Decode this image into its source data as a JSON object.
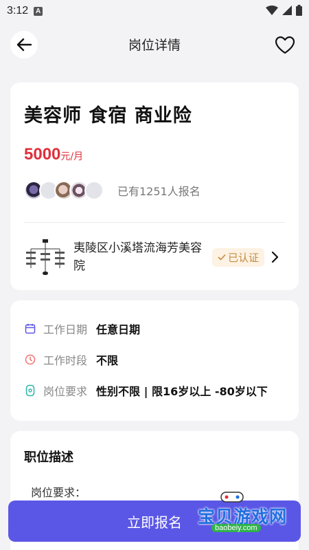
{
  "status_bar": {
    "time": "3:12",
    "badge": "A"
  },
  "header": {
    "title": "岗位详情"
  },
  "job": {
    "title": "美容师 食宿 商业险",
    "salary_amount": "5000",
    "salary_unit": "元/月",
    "applicants": "已有1251人报名"
  },
  "company": {
    "name": "夷陵区小溪塔流海芳美容院",
    "verified_label": "已认证"
  },
  "info": [
    {
      "icon": "calendar-icon",
      "label": "工作日期",
      "value": "任意日期"
    },
    {
      "icon": "clock-icon",
      "label": "工作时段",
      "value": "不限"
    },
    {
      "icon": "requirement-icon",
      "label": "岗位要求",
      "value": "性别不限 | 限16岁以上 -80岁以下"
    }
  ],
  "description": {
    "title": "职位描述",
    "subtitle": "岗位要求："
  },
  "apply_button": "立即报名",
  "watermark": {
    "text": "宝贝游戏网",
    "url": "baobeiy.com"
  },
  "colors": {
    "accent": "#5b57e6",
    "salary": "#e0303b",
    "verified_bg": "#fdf2e3",
    "verified_text": "#c48a3e"
  }
}
